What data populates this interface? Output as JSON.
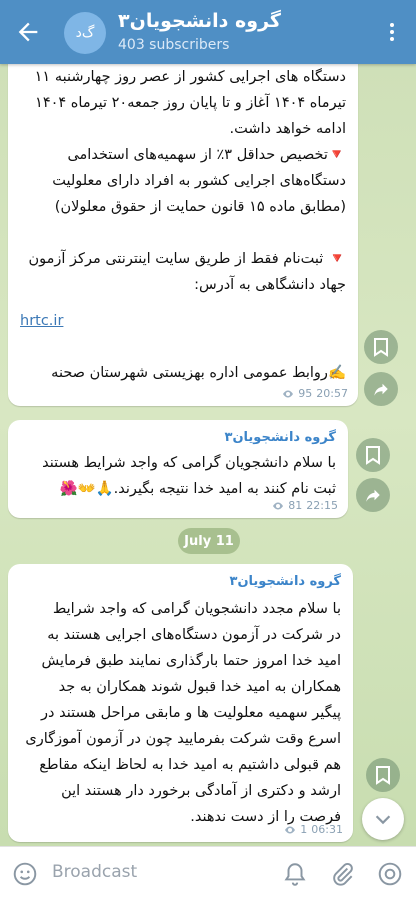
{
  "header": {
    "title": "گروه دانشجویان۳",
    "subtitle": "403 subscribers",
    "avatar_text": "گ‌د"
  },
  "messages": [
    {
      "lines": [
        "دستگاه های اجرایی کشور از عصر روز چهارشنبه ۱۱",
        "تیرماه ۱۴۰۴ آغاز و تا پایان روز جمعه۲۰ تیرماه ۱۴۰۴",
        "ادامه خواهد داشت.",
        "🔻تخصیص حداقل ۳٪ از سهمیه‌های استخدامی",
        "دستگاه‌های اجرایی کشور به افراد دارای معلولیت",
        "(مطابق ماده ۱۵ قانون حمایت از حقوق معلولان)",
        "",
        "🔻 ثبت‌نام فقط از طریق سایت اینترنتی مرکز آزمون",
        "جهاد دانشگاهی به آدرس:"
      ],
      "link": "hrtc.ir",
      "signature": "✍️روابط عمومی اداره بهزیستی شهرستان صحنه",
      "views": "95",
      "time": "20:57"
    },
    {
      "sender": "گروه دانشجویان۳",
      "lines": [
        "با سلام دانشجویان گرامی که واجد شرایط هستند",
        "ثبت نام کنند به امید خدا نتیجه بگیرند.🙏👐🌺"
      ],
      "views": "81",
      "time": "22:15"
    },
    {
      "sender": "گروه دانشجویان۳",
      "lines": [
        "با سلام مجدد دانشجویان گرامی که واجد شرایط",
        "در شرکت در آزمون دستگاه‌های اجرایی هستند به",
        "امید خدا امروز حتما بارگذاری نمایند طبق فرمایش",
        "همکاران به امید خدا قبول شوند همکاران به جد",
        "پیگیر سهمیه معلولیت ها و مابقی مراحل هستند در",
        "اسرع وقت شرکت بفرمایید چون در آزمون آموزگاری",
        "هم قبولی داشتیم به امید خدا به لحاظ اینکه مقاطع",
        "ارشد و دکتری از آمادگی برخورد دار هستند این",
        "فرصت را از دست ندهند."
      ],
      "views": "1",
      "time": "06:31"
    }
  ],
  "date_divider": "July 11",
  "input": {
    "placeholder": "Broadcast"
  },
  "icons": {
    "back": "back-arrow-icon",
    "menu": "more-vertical-icon",
    "bookmark": "bookmark-icon",
    "share": "share-icon",
    "scroll_down": "chevron-down-icon",
    "emoji": "smile-icon",
    "bell": "bell-icon",
    "attach": "paperclip-icon",
    "camera": "camera-icon",
    "views": "eye-icon"
  },
  "colors": {
    "header": "#4f8fc5",
    "link": "#3b78b6",
    "sender": "#3b84c9"
  }
}
